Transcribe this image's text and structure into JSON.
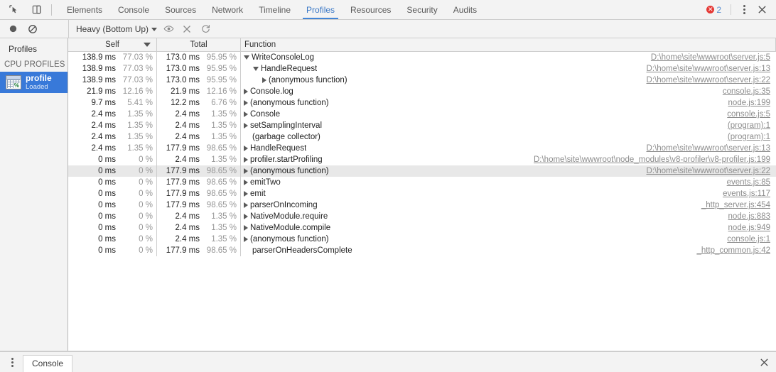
{
  "tabbar": {
    "inspect_icon": "inspect-element-icon",
    "device_icon": "toggle-device-toolbar-icon",
    "tabs": [
      {
        "label": "Elements",
        "active": false
      },
      {
        "label": "Console",
        "active": false
      },
      {
        "label": "Sources",
        "active": false
      },
      {
        "label": "Network",
        "active": false
      },
      {
        "label": "Timeline",
        "active": false
      },
      {
        "label": "Profiles",
        "active": true
      },
      {
        "label": "Resources",
        "active": false
      },
      {
        "label": "Security",
        "active": false
      },
      {
        "label": "Audits",
        "active": false
      }
    ],
    "error_count": "2",
    "menu_icon": "kebab-menu-icon",
    "close_icon": "close-icon"
  },
  "toolbar": {
    "record_icon": "record-icon",
    "clear_icon": "clear-icon",
    "view_mode": "Heavy (Bottom Up)",
    "focus_icon": "eye-focus-icon",
    "exclude_icon": "exclude-x-icon",
    "restore_icon": "restore-refresh-icon"
  },
  "sidebar": {
    "title": "Profiles",
    "group_label": "CPU PROFILES",
    "items": [
      {
        "name": "profile",
        "status": "Loaded",
        "icon": "cpu-profile-icon",
        "selected": true
      }
    ]
  },
  "grid": {
    "columns": [
      {
        "key": "self",
        "label": "Self",
        "sorted": true,
        "sort_dir": "desc"
      },
      {
        "key": "total",
        "label": "Total"
      },
      {
        "key": "function",
        "label": "Function"
      }
    ],
    "rows": [
      {
        "self_ms": "138.9 ms",
        "self_pct": "77.03 %",
        "total_ms": "173.0 ms",
        "total_pct": "95.95 %",
        "name": "WriteConsoleLog",
        "depth": 0,
        "disclosure": "open",
        "url": "D:\\home\\site\\wwwroot\\server.js:5",
        "selected": false
      },
      {
        "self_ms": "138.9 ms",
        "self_pct": "77.03 %",
        "total_ms": "173.0 ms",
        "total_pct": "95.95 %",
        "name": "HandleRequest",
        "depth": 1,
        "disclosure": "open",
        "url": "D:\\home\\site\\wwwroot\\server.js:13",
        "selected": false
      },
      {
        "self_ms": "138.9 ms",
        "self_pct": "77.03 %",
        "total_ms": "173.0 ms",
        "total_pct": "95.95 %",
        "name": "(anonymous function)",
        "depth": 2,
        "disclosure": "closed",
        "url": "D:\\home\\site\\wwwroot\\server.js:22",
        "selected": false
      },
      {
        "self_ms": "21.9 ms",
        "self_pct": "12.16 %",
        "total_ms": "21.9 ms",
        "total_pct": "12.16 %",
        "name": "Console.log",
        "depth": 0,
        "disclosure": "closed",
        "url": "console.js:35",
        "selected": false
      },
      {
        "self_ms": "9.7 ms",
        "self_pct": "5.41 %",
        "total_ms": "12.2 ms",
        "total_pct": "6.76 %",
        "name": "(anonymous function)",
        "depth": 0,
        "disclosure": "closed",
        "url": "node.js:199",
        "selected": false
      },
      {
        "self_ms": "2.4 ms",
        "self_pct": "1.35 %",
        "total_ms": "2.4 ms",
        "total_pct": "1.35 %",
        "name": "Console",
        "depth": 0,
        "disclosure": "closed",
        "url": "console.js:5",
        "selected": false
      },
      {
        "self_ms": "2.4 ms",
        "self_pct": "1.35 %",
        "total_ms": "2.4 ms",
        "total_pct": "1.35 %",
        "name": "setSamplingInterval",
        "depth": 0,
        "disclosure": "closed",
        "url": "(program):1",
        "selected": false
      },
      {
        "self_ms": "2.4 ms",
        "self_pct": "1.35 %",
        "total_ms": "2.4 ms",
        "total_pct": "1.35 %",
        "name": "(garbage collector)",
        "depth": 0,
        "disclosure": "none",
        "url": "(program):1",
        "selected": false
      },
      {
        "self_ms": "2.4 ms",
        "self_pct": "1.35 %",
        "total_ms": "177.9 ms",
        "total_pct": "98.65 %",
        "name": "HandleRequest",
        "depth": 0,
        "disclosure": "closed",
        "url": "D:\\home\\site\\wwwroot\\server.js:13",
        "selected": false
      },
      {
        "self_ms": "0 ms",
        "self_pct": "0 %",
        "total_ms": "2.4 ms",
        "total_pct": "1.35 %",
        "name": "profiler.startProfiling",
        "depth": 0,
        "disclosure": "closed",
        "url": "D:\\home\\site\\wwwroot\\node_modules\\v8-profiler\\v8-profiler.js:199",
        "selected": false
      },
      {
        "self_ms": "0 ms",
        "self_pct": "0 %",
        "total_ms": "177.9 ms",
        "total_pct": "98.65 %",
        "name": "(anonymous function)",
        "depth": 0,
        "disclosure": "closed",
        "url": "D:\\home\\site\\wwwroot\\server.js:22",
        "selected": true
      },
      {
        "self_ms": "0 ms",
        "self_pct": "0 %",
        "total_ms": "177.9 ms",
        "total_pct": "98.65 %",
        "name": "emitTwo",
        "depth": 0,
        "disclosure": "closed",
        "url": "events.js:85",
        "selected": false
      },
      {
        "self_ms": "0 ms",
        "self_pct": "0 %",
        "total_ms": "177.9 ms",
        "total_pct": "98.65 %",
        "name": "emit",
        "depth": 0,
        "disclosure": "closed",
        "url": "events.js:117",
        "selected": false
      },
      {
        "self_ms": "0 ms",
        "self_pct": "0 %",
        "total_ms": "177.9 ms",
        "total_pct": "98.65 %",
        "name": "parserOnIncoming",
        "depth": 0,
        "disclosure": "closed",
        "url": "_http_server.js:454",
        "selected": false
      },
      {
        "self_ms": "0 ms",
        "self_pct": "0 %",
        "total_ms": "2.4 ms",
        "total_pct": "1.35 %",
        "name": "NativeModule.require",
        "depth": 0,
        "disclosure": "closed",
        "url": "node.js:883",
        "selected": false
      },
      {
        "self_ms": "0 ms",
        "self_pct": "0 %",
        "total_ms": "2.4 ms",
        "total_pct": "1.35 %",
        "name": "NativeModule.compile",
        "depth": 0,
        "disclosure": "closed",
        "url": "node.js:949",
        "selected": false
      },
      {
        "self_ms": "0 ms",
        "self_pct": "0 %",
        "total_ms": "2.4 ms",
        "total_pct": "1.35 %",
        "name": "(anonymous function)",
        "depth": 0,
        "disclosure": "closed",
        "url": "console.js:1",
        "selected": false
      },
      {
        "self_ms": "0 ms",
        "self_pct": "0 %",
        "total_ms": "177.9 ms",
        "total_pct": "98.65 %",
        "name": "parserOnHeadersComplete",
        "depth": 0,
        "disclosure": "none",
        "url": "_http_common.js:42",
        "selected": false
      }
    ]
  },
  "drawer": {
    "menu_icon": "kebab-menu-icon",
    "tabs": [
      {
        "label": "Console",
        "active": true
      }
    ],
    "close_icon": "close-icon"
  },
  "colors": {
    "accent": "#4285d6",
    "selection": "#3879d9",
    "error": "#e53935",
    "toolbar_bg": "#f3f3f3",
    "row_hover": "#e8e8e8"
  }
}
